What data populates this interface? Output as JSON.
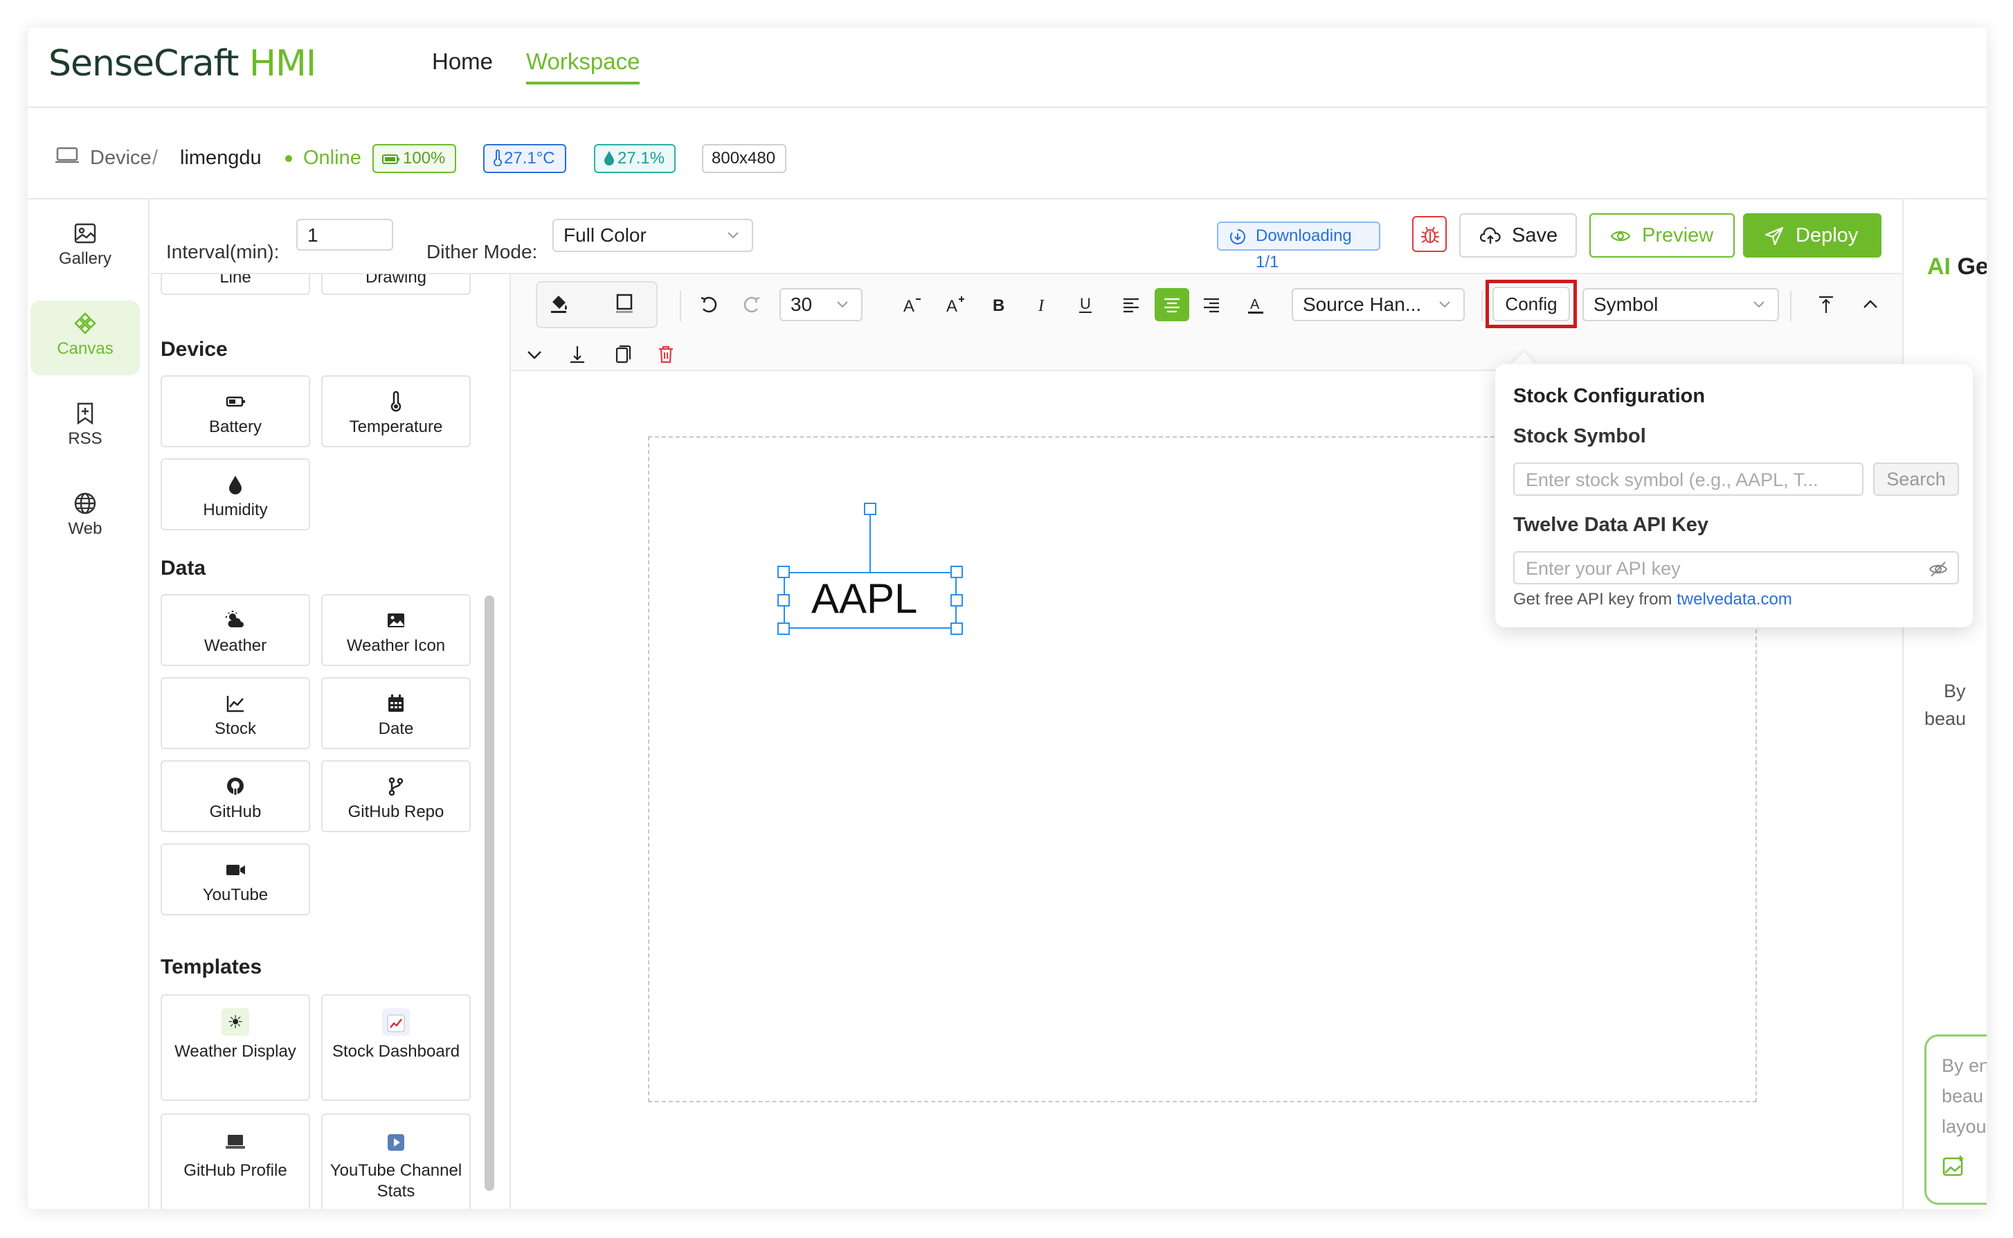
{
  "app": {
    "logo_part1": "SenseCraft",
    "logo_part2": "HMI",
    "nav": {
      "home": "Home",
      "workspace": "Workspace"
    }
  },
  "device_bar": {
    "crumb": "Device",
    "separator": "/",
    "device_name": "limengdu",
    "status": "Online",
    "battery": "100%",
    "temperature": "27.1°C",
    "humidity": "27.1%",
    "resolution": "800x480"
  },
  "rail": [
    {
      "label": "Gallery",
      "icon": "image-icon"
    },
    {
      "label": "Canvas",
      "icon": "canvas-icon",
      "active": true
    },
    {
      "label": "RSS",
      "icon": "bookmark-plus-icon"
    },
    {
      "label": "Web",
      "icon": "globe-icon"
    }
  ],
  "settings": {
    "interval_label": "Interval(min):",
    "interval_value": "1",
    "dither_label": "Dither Mode:",
    "dither_value": "Full Color"
  },
  "actions": {
    "downloading": "Downloading 1/1",
    "save": "Save",
    "preview": "Preview",
    "deploy": "Deploy"
  },
  "widgets": {
    "basic": [
      "Line",
      "Drawing"
    ],
    "device_title": "Device",
    "device": [
      "Battery",
      "Temperature",
      "Humidity"
    ],
    "data_title": "Data",
    "data": [
      "Weather",
      "Weather Icon",
      "Stock",
      "Date",
      "GitHub",
      "GitHub Repo",
      "YouTube"
    ],
    "templates_title": "Templates",
    "templates": [
      "Weather Display",
      "Stock Dashboard",
      "GitHub Profile",
      "YouTube Channel Stats"
    ]
  },
  "editor_toolbar": {
    "font_size": "30",
    "font_family": "Source Han...",
    "config": "Config",
    "symbol_type": "Symbol"
  },
  "canvas": {
    "text_element": "AAPL"
  },
  "stock_config": {
    "title": "Stock Configuration",
    "symbol_label": "Stock Symbol",
    "symbol_placeholder": "Enter stock symbol (e.g., AAPL, T...",
    "search": "Search",
    "api_label": "Twelve Data API Key",
    "api_placeholder": "Enter your API key",
    "note": "Get free API key from ",
    "link": "twelvedata.com"
  },
  "ai_panel": {
    "title_part1": "AI",
    "title_part2": "Ger",
    "desc_line1": "By",
    "desc_line2": "beau",
    "box_line1": "By en",
    "box_line2": "beau",
    "box_line3": "layou"
  },
  "colors": {
    "accent": "#6dbb2b",
    "link": "#2a6fdb",
    "highlight": "#cc1b1b",
    "selection": "#2a8ef0"
  }
}
